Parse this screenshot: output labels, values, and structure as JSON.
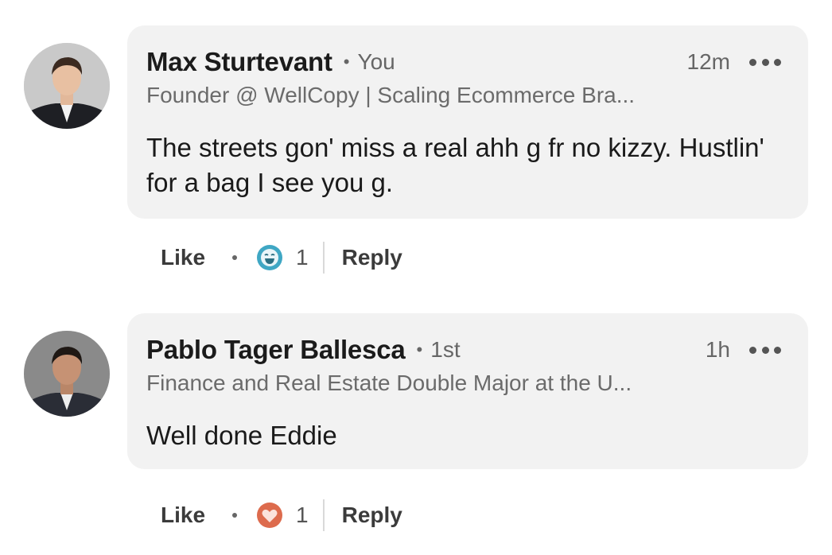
{
  "comments": [
    {
      "author": "Max Sturtevant",
      "degree": "You",
      "time": "12m",
      "headline": "Founder @ WellCopy | Scaling Ecommerce Bra...",
      "text": "The streets gon' miss a real ahh g fr no kizzy. Hustlin' for a bag I see you g.",
      "like_label": "Like",
      "reaction_icon": "funny-reaction-icon",
      "reaction_color": "#3fa7c4",
      "reaction_count": "1",
      "reply_label": "Reply"
    },
    {
      "author": "Pablo Tager Ballesca",
      "degree": "1st",
      "time": "1h",
      "headline": "Finance and Real Estate Double Major at the U...",
      "text": "Well done Eddie",
      "like_label": "Like",
      "reaction_icon": "love-reaction-icon",
      "reaction_color": "#dd6b4d",
      "reaction_count": "1",
      "reply_label": "Reply"
    }
  ]
}
